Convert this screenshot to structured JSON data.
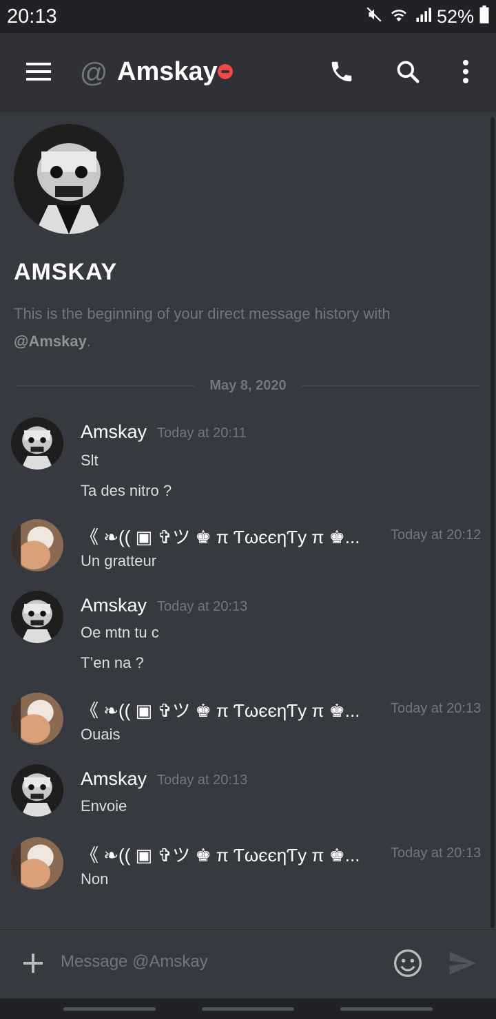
{
  "status_bar": {
    "time": "20:13",
    "battery": "52%",
    "icons": [
      "mute-icon",
      "wifi-icon",
      "signal-icon",
      "battery-icon"
    ]
  },
  "header": {
    "at_symbol": "@",
    "title": "Amskay",
    "status": "do-not-disturb",
    "icons": [
      "menu-icon",
      "phone-icon",
      "search-icon",
      "more-icon"
    ]
  },
  "intro": {
    "name": "AMSKAY",
    "text": "This is the beginning of your direct message history with ",
    "handle": "@Amskay",
    "suffix": "."
  },
  "date_divider": "May 8, 2020",
  "messages": [
    {
      "author": "Amskay",
      "time": "Today at 20:11",
      "lines": [
        "Slt",
        "Ta des nitro ?"
      ]
    },
    {
      "author": "《 ❧(( ▣ ✞ツ ♚ π ƬωєєηƬу π ♚...",
      "time": "Today at 20:12",
      "lines": [
        "Un gratteur"
      ]
    },
    {
      "author": "Amskay",
      "time": "Today at 20:13",
      "lines": [
        "Oe mtn tu c",
        "T’en na ?"
      ]
    },
    {
      "author": "《 ❧(( ▣ ✞ツ ♚ π ƬωєєηƬу π ♚...",
      "time": "Today at 20:13",
      "lines": [
        "Ouais"
      ]
    },
    {
      "author": "Amskay",
      "time": "Today at 20:13",
      "lines": [
        "Envoie"
      ]
    },
    {
      "author": "《 ❧(( ▣ ✞ツ ♚ π ƬωєєηƬу π ♚...",
      "time": "Today at 20:13",
      "lines": [
        "Non"
      ]
    }
  ],
  "composer": {
    "placeholder": "Message @Amskay",
    "icons": [
      "add-icon",
      "emoji-icon",
      "send-icon"
    ]
  },
  "colors": {
    "background": "#36393f",
    "header": "#2f3136",
    "status_bar": "#202225",
    "dnd": "#f04747",
    "muted_text": "#72767d"
  }
}
